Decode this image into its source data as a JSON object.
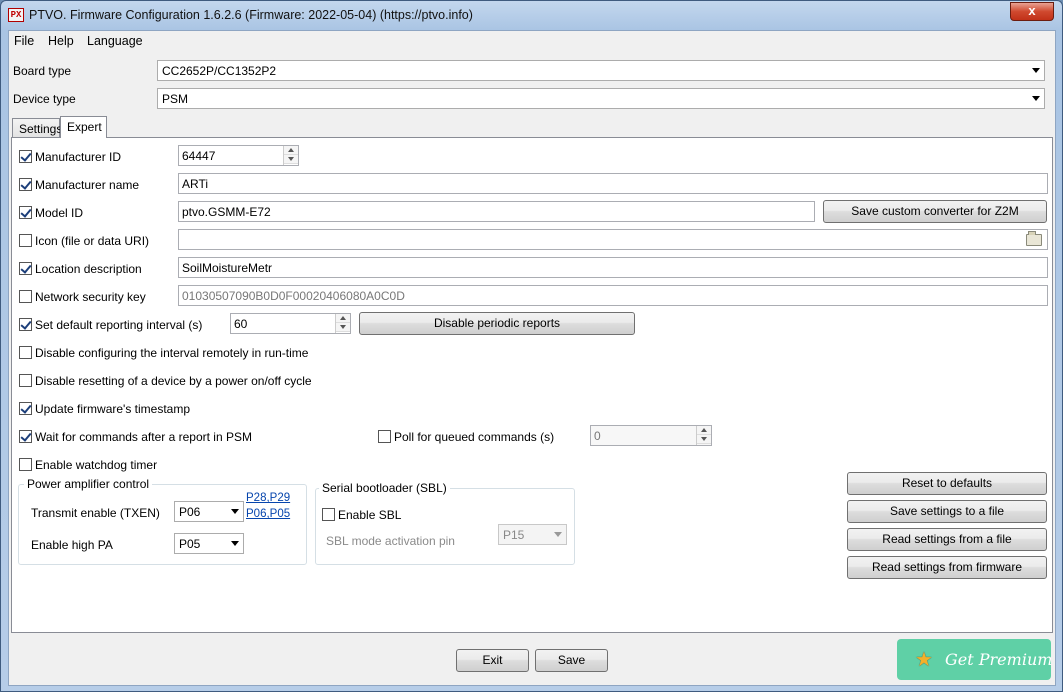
{
  "window": {
    "icon_text": "PX",
    "title": "PTVO. Firmware Configuration 1.6.2.6 (Firmware: 2022-05-04) (https://ptvo.info)",
    "close": "x"
  },
  "menu": {
    "file": "File",
    "help": "Help",
    "language": "Language"
  },
  "board_type": {
    "label": "Board type",
    "value": "CC2652P/CC1352P2"
  },
  "device_type": {
    "label": "Device type",
    "value": "PSM"
  },
  "tabs": [
    {
      "label": "Settings",
      "active": false
    },
    {
      "label": "Expert",
      "active": true
    }
  ],
  "expert": {
    "manufacturer_id": {
      "label": "Manufacturer ID",
      "checked": true,
      "value": "64447"
    },
    "manufacturer_name": {
      "label": "Manufacturer name",
      "checked": true,
      "value": "ARTi"
    },
    "model_id": {
      "label": "Model ID",
      "checked": true,
      "value": "ptvo.GSMM-E72",
      "button": "Save custom converter for Z2M"
    },
    "icon": {
      "label": "Icon (file or data URI)",
      "checked": false,
      "value": ""
    },
    "location": {
      "label": "Location description",
      "checked": true,
      "value": "SoilMoistureMetr"
    },
    "security_key": {
      "label": "Network security key",
      "checked": false,
      "value": "01030507090B0D0F00020406080A0C0D"
    },
    "reporting": {
      "label": "Set default reporting interval (s)",
      "checked": true,
      "value": "60",
      "button": "Disable periodic reports"
    },
    "disable_config_interval": {
      "label": "Disable configuring the interval remotely in run-time",
      "checked": false
    },
    "disable_reset": {
      "label": "Disable resetting of a device by a power on/off cycle",
      "checked": false
    },
    "update_timestamp": {
      "label": "Update firmware's timestamp",
      "checked": true
    },
    "wait_commands": {
      "label": "Wait for commands after a report in PSM",
      "checked": true
    },
    "poll_queued": {
      "label": "Poll for queued commands (s)",
      "checked": false,
      "value": "0"
    },
    "watchdog": {
      "label": "Enable watchdog timer",
      "checked": false
    }
  },
  "power_amp": {
    "title": "Power amplifier control",
    "txen_label": "Transmit enable (TXEN)",
    "txen_value": "P06",
    "link1": "P28,P29",
    "link2": "P06,P05",
    "high_pa_label": "Enable high PA",
    "high_pa_value": "P05"
  },
  "sbl": {
    "title": "Serial bootloader (SBL)",
    "enable_label": "Enable SBL",
    "enable_checked": false,
    "pin_label": "SBL mode activation pin",
    "pin_value": "P15"
  },
  "side_buttons": {
    "reset": "Reset to defaults",
    "save_file": "Save settings to a file",
    "read_file": "Read settings from a file",
    "read_fw": "Read settings from firmware"
  },
  "footer": {
    "exit": "Exit",
    "save": "Save",
    "premium": "Get Premium"
  }
}
